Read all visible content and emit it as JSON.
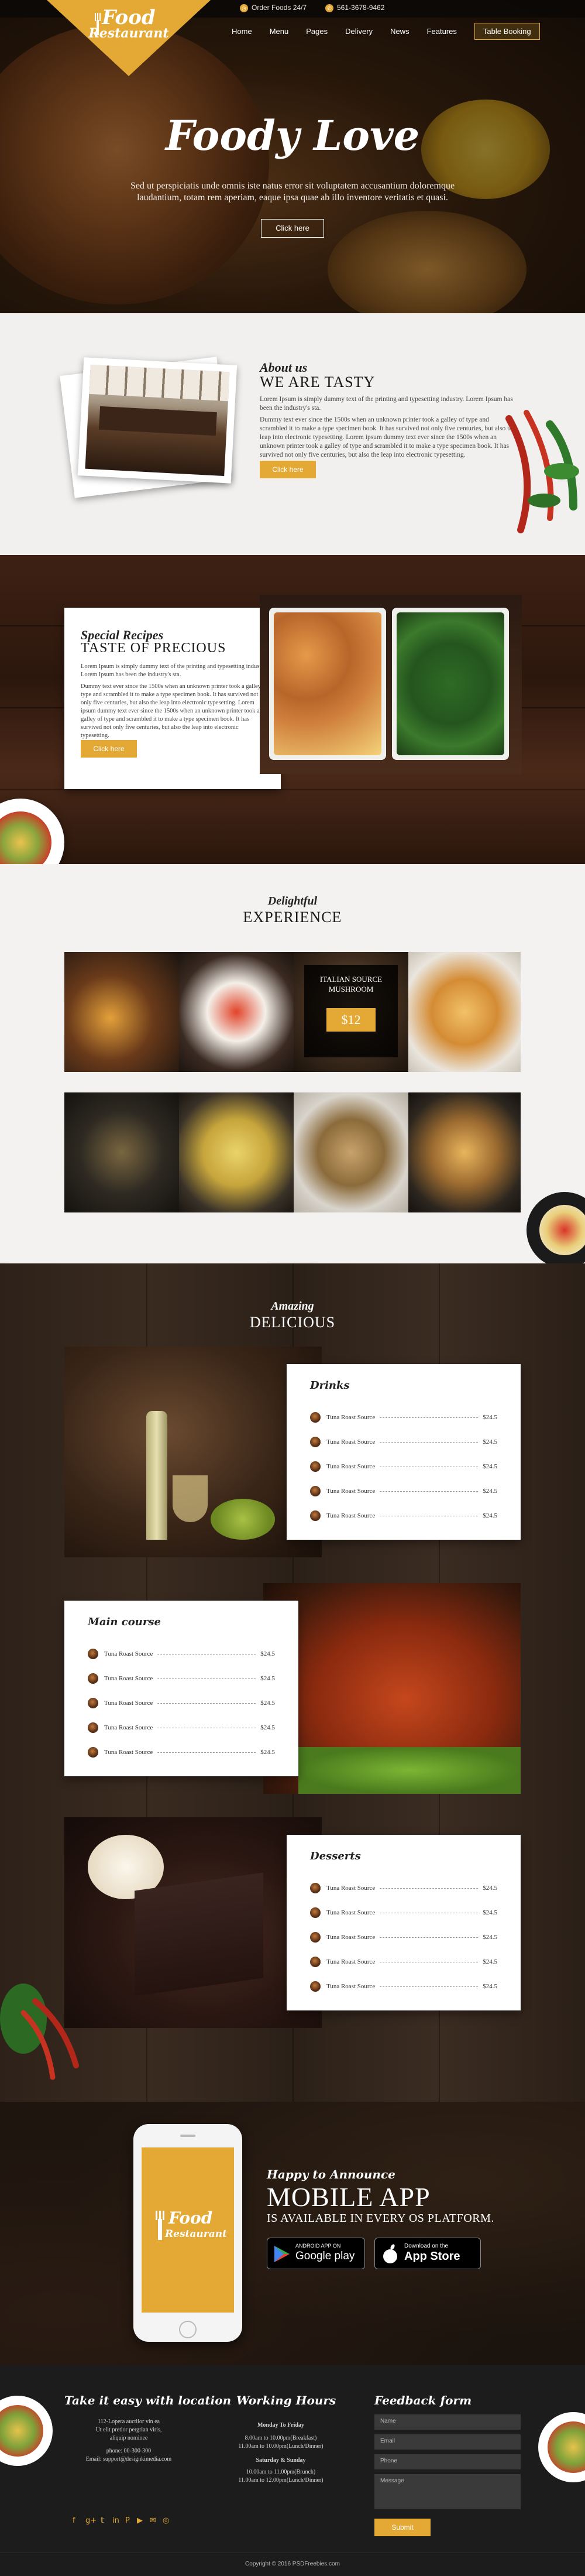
{
  "header": {
    "logo_line1": "Food",
    "logo_line2": "Restaurant",
    "open_hours": "Order Foods 24/7",
    "phone": "561-3678-9462",
    "nav": [
      "Home",
      "Menu",
      "Pages",
      "Delivery",
      "News",
      "Features"
    ],
    "booking_label": "Table Booking",
    "hero_title": "Foody Love",
    "hero_text": "Sed ut perspiciatis unde omnis iste natus error sit voluptatem accusantium doloremque laudantium, totam rem aperiam, eaque ipsa quae ab illo inventore veritatis et quasi.",
    "hero_button": "Click here"
  },
  "about": {
    "script": "About us",
    "title": "WE ARE TASTY",
    "para1": "Lorem Ipsum is simply dummy text of the printing and typesetting industry. Lorem Ipsum has been the industry's sta.",
    "para2": "Dummy text ever since the 1500s when an unknown printer took a galley of type and scrambled it to make a type specimen book. It has survived not only five centuries, but also the leap into electronic typesetting. Lorem ipsum dummy text ever since the 1500s when an unknown printer took a galley of type and scrambled it to make a type specimen book. It has survived not only five centuries, but also the leap into electronic typesetting.",
    "button": "Click here"
  },
  "special": {
    "script": "Special Recipes",
    "title": "TASTE OF PRECIOUS",
    "para1": "Lorem Ipsum is simply dummy text of the printing and typesetting industry. Lorem Ipsum has been the industry's sta.",
    "para2": "Dummy text ever since the 1500s when an unknown printer took a galley of type and scrambled it to make a type specimen book. It has survived not only five centuries, but also the leap into electronic typesetting. Lorem ipsum dummy text ever since the 1500s when an unknown printer took a galley of type and scrambled it to make a type specimen book. It has survived not only five centuries, but also the leap into electronic typesetting.",
    "button": "Click here"
  },
  "experience": {
    "script": "Delightful",
    "title": "EXPERIENCE",
    "feature_name": "ITALIAN SOURCE MUSHROOM",
    "feature_price": "$12"
  },
  "menu": {
    "script": "Amazing",
    "title": "DELICIOUS",
    "drinks": {
      "title": "Drinks",
      "items": [
        {
          "name": "Tuna Roast Source",
          "price": "$24.5"
        },
        {
          "name": "Tuna Roast Source",
          "price": "$24.5"
        },
        {
          "name": "Tuna Roast Source",
          "price": "$24.5"
        },
        {
          "name": "Tuna Roast Source",
          "price": "$24.5"
        },
        {
          "name": "Tuna Roast Source",
          "price": "$24.5"
        }
      ]
    },
    "main_course": {
      "title": "Main course",
      "items": [
        {
          "name": "Tuna Roast Source",
          "price": "$24.5"
        },
        {
          "name": "Tuna Roast Source",
          "price": "$24.5"
        },
        {
          "name": "Tuna Roast Source",
          "price": "$24.5"
        },
        {
          "name": "Tuna Roast Source",
          "price": "$24.5"
        },
        {
          "name": "Tuna Roast Source",
          "price": "$24.5"
        }
      ]
    },
    "desserts": {
      "title": "Desserts",
      "items": [
        {
          "name": "Tuna Roast Source",
          "price": "$24.5"
        },
        {
          "name": "Tuna Roast Source",
          "price": "$24.5"
        },
        {
          "name": "Tuna Roast Source",
          "price": "$24.5"
        },
        {
          "name": "Tuna Roast Source",
          "price": "$24.5"
        },
        {
          "name": "Tuna Roast Source",
          "price": "$24.5"
        }
      ]
    }
  },
  "app": {
    "script": "Happy to Announce",
    "title": "MOBILE APP",
    "subtitle": "IS AVAILABLE IN EVERY OS PLATFORM.",
    "phone_logo1": "Food",
    "phone_logo2": "Restaurant",
    "google_small": "ANDROID APP ON",
    "google_big": "Google play",
    "apple_small": "Download on the",
    "apple_big": "App Store"
  },
  "footer": {
    "location_title": "Take it easy with location",
    "address1": "112-Lopera auctiior vin ea",
    "address2": "Ut elit pretior pergrian viris,",
    "address3": "aliquip nominee",
    "phone": "phone: 00-300-300",
    "email": "Email: support@designkimedia.com",
    "hours_title": "Working Hours",
    "hours_label1": "Monday To Friday",
    "hours_l1": "8.00am to 10.00pm(Breakfast)",
    "hours_l2": "11.00am to 10.00pm(Lunch/Dinner)",
    "hours_label2": "Saturday & Sunday",
    "hours_l3": "10.00am to 11.00pm(Brunch)",
    "hours_l4": "11.00am to 12.00pm(Lunch/Dinner)",
    "feedback_title": "Feedback form",
    "name_placeholder": "Name",
    "email_placeholder": "Email",
    "phone_placeholder": "Phone",
    "message_placeholder": "Message",
    "submit": "Submit",
    "copyright": "Copyright © 2016 PSDFreebies.com"
  },
  "colors": {
    "accent": "#e3a934",
    "dark": "#1c1c1c"
  }
}
